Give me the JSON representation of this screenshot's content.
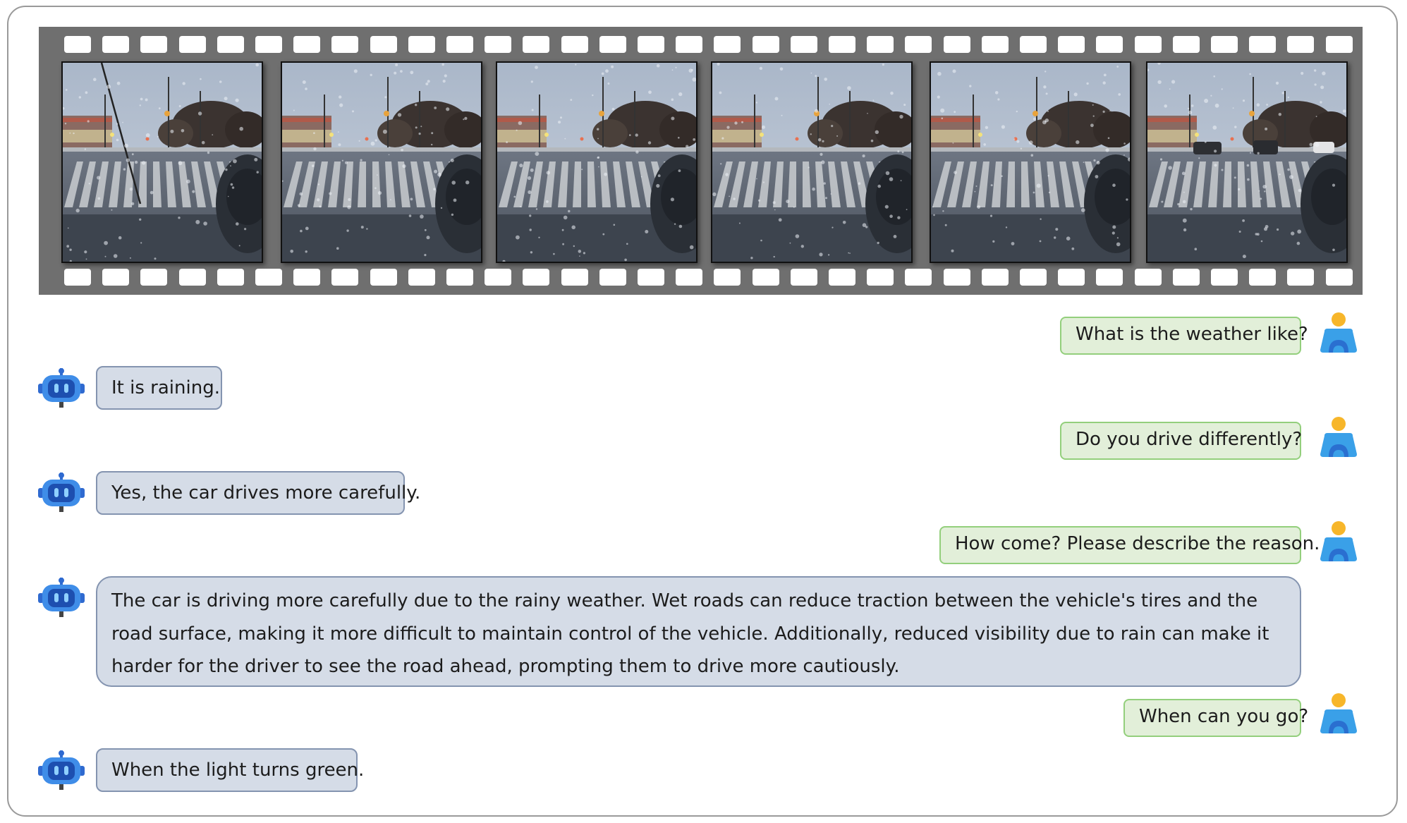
{
  "colors": {
    "user_bubble_bg": "#e2efd9",
    "user_bubble_border": "#93cf7c",
    "bot_bubble_bg": "#d5dce7",
    "bot_bubble_border": "#8494b0",
    "film_strip": "#6f6f6f"
  },
  "film_strip": {
    "frame_count": 6,
    "frame_description": "Rainy street intersection viewed through a wet windshield, crosswalk in front"
  },
  "icons": {
    "user": "user-avatar-icon",
    "assistant": "robot-assistant-icon"
  },
  "conversation": [
    {
      "role": "user",
      "text": "What is the weather like?"
    },
    {
      "role": "assistant",
      "text": "It is raining."
    },
    {
      "role": "user",
      "text": "Do you drive differently?"
    },
    {
      "role": "assistant",
      "text": "Yes, the car drives more carefully."
    },
    {
      "role": "user",
      "text": "How come? Please describe the reason."
    },
    {
      "role": "assistant",
      "text": "The car is driving more carefully due to the rainy weather. Wet roads can reduce traction between the vehicle's tires and the road surface, making it more difficult to maintain control of the vehicle. Additionally, reduced visibility due to rain can make it harder for the driver to see the road ahead, prompting them to drive more cautiously."
    },
    {
      "role": "user",
      "text": "When can you go?"
    },
    {
      "role": "assistant",
      "text": "When the light turns green."
    }
  ]
}
